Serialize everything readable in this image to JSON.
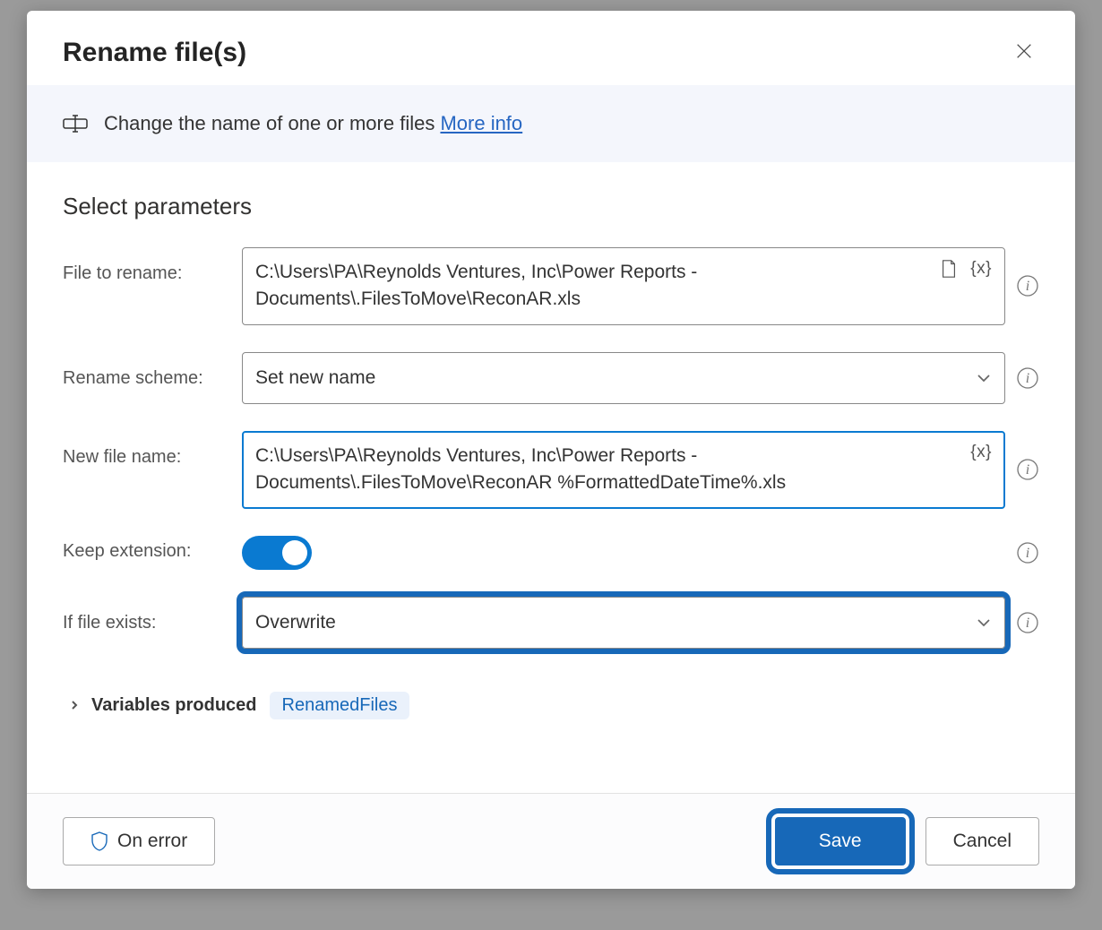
{
  "header": {
    "title": "Rename file(s)"
  },
  "info": {
    "text": "Change the name of one or more files ",
    "link_label": "More info"
  },
  "section_title": "Select parameters",
  "fields": {
    "file_to_rename": {
      "label": "File to rename:",
      "value": "C:\\Users\\PA\\Reynolds Ventures, Inc\\Power Reports - Documents\\.FilesToMove\\ReconAR.xls"
    },
    "rename_scheme": {
      "label": "Rename scheme:",
      "value": "Set new name"
    },
    "new_file_name": {
      "label": "New file name:",
      "value": "C:\\Users\\PA\\Reynolds Ventures, Inc\\Power Reports - Documents\\.FilesToMove\\ReconAR %FormattedDateTime%.xls"
    },
    "keep_extension": {
      "label": "Keep extension:",
      "value": true
    },
    "if_file_exists": {
      "label": "If file exists:",
      "value": "Overwrite"
    }
  },
  "variables_produced": {
    "label": "Variables produced",
    "chip": "RenamedFiles"
  },
  "footer": {
    "on_error": "On error",
    "save": "Save",
    "cancel": "Cancel"
  },
  "tokens": {
    "variable_token": "{x}"
  }
}
